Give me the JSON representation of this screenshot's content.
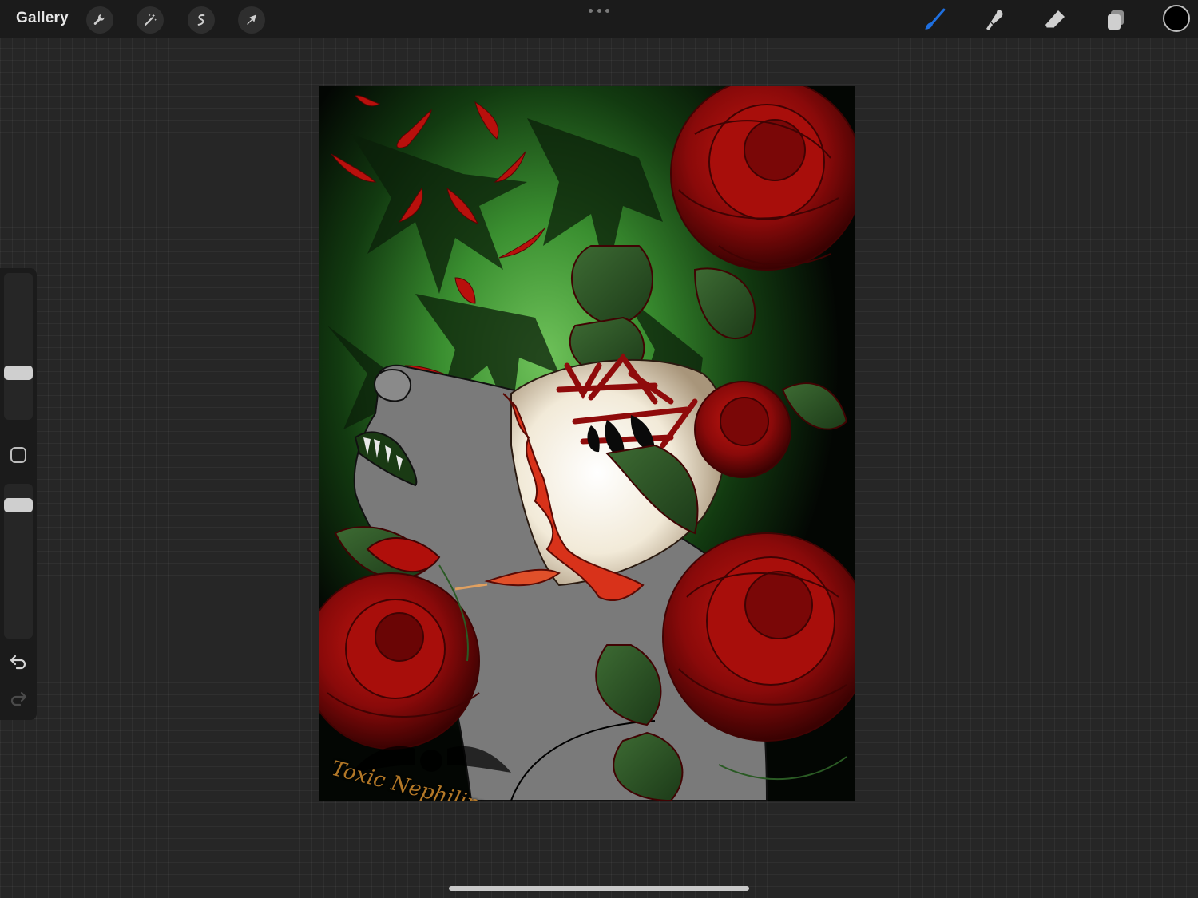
{
  "app": {
    "name": "Procreate"
  },
  "topbar": {
    "gallery_label": "Gallery",
    "left_tools": [
      {
        "name": "wrench-icon",
        "purpose": "actions"
      },
      {
        "name": "magic-wand-icon",
        "purpose": "adjustments"
      },
      {
        "name": "s-curve-icon",
        "purpose": "selection"
      },
      {
        "name": "arrow-cursor-icon",
        "purpose": "transform"
      }
    ],
    "right_tools": [
      {
        "name": "brush-icon",
        "purpose": "paint",
        "active": true
      },
      {
        "name": "smudge-icon",
        "purpose": "smudge",
        "active": false
      },
      {
        "name": "eraser-icon",
        "purpose": "erase",
        "active": false
      },
      {
        "name": "layers-icon",
        "purpose": "layers",
        "active": false
      }
    ],
    "current_color": "#000000",
    "active_tool_color": "#1e6fe0"
  },
  "sidebar": {
    "brush_size_level": 0.3,
    "opacity_level": 0.9,
    "icons": [
      "modifier-square-icon",
      "undo-icon",
      "redo-icon"
    ]
  },
  "canvas": {
    "signature_text": "Toxic Nephilim"
  },
  "colors": {
    "toolbar_bg": "#1b1b1b",
    "workspace_bg": "#262626",
    "rose_red": "#8a0a0a",
    "leaf_green": "#2e5a28",
    "glow_green": "#3e9a32",
    "fur_grey": "#7a7a7a"
  }
}
